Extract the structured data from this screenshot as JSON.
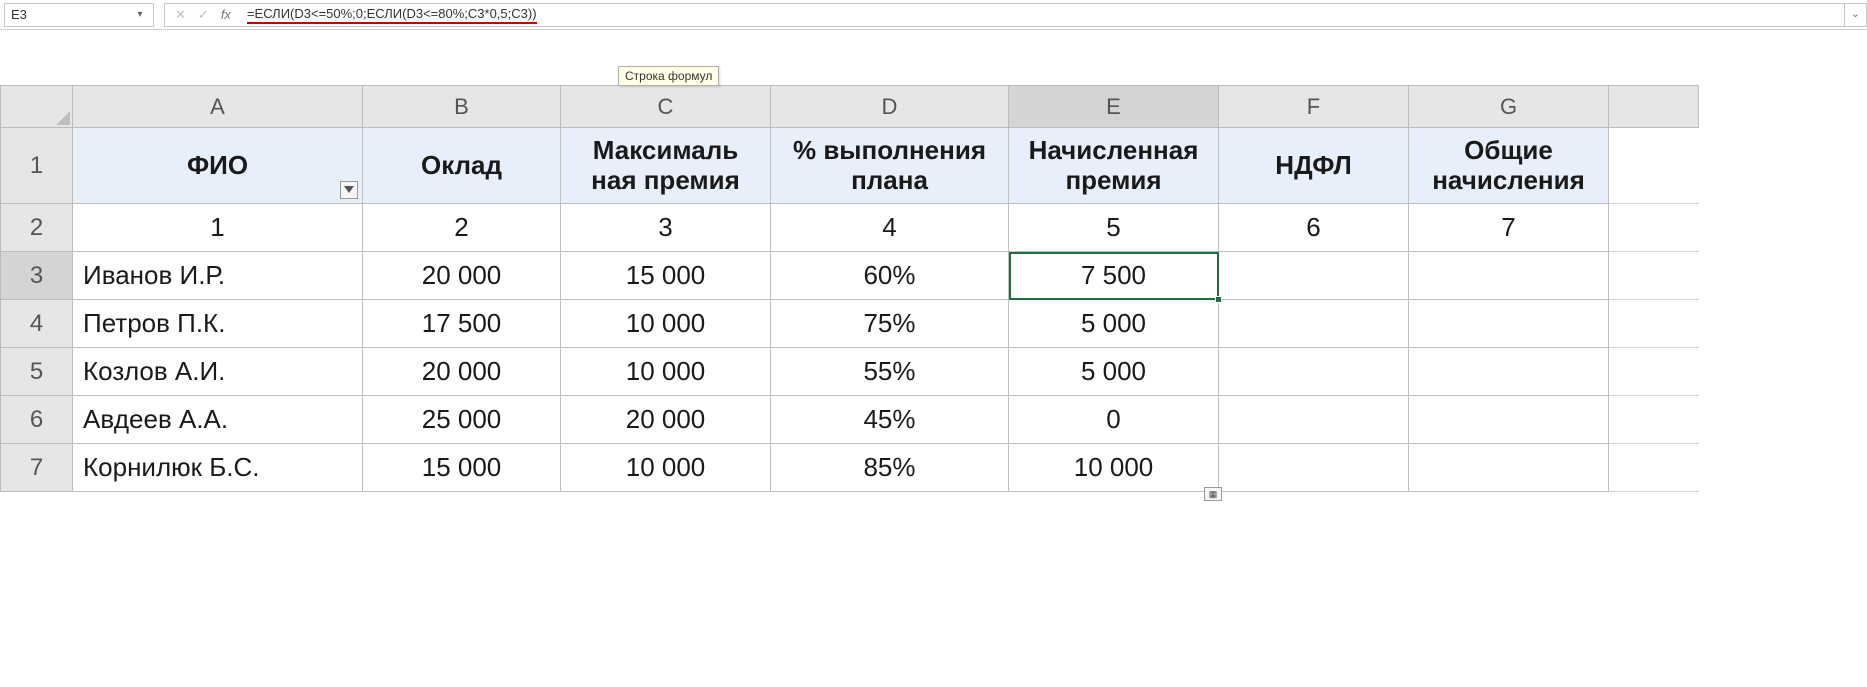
{
  "name_box": {
    "value": "E3"
  },
  "formula_bar": {
    "formula": "=ЕСЛИ(D3<=50%;0;ЕСЛИ(D3<=80%;C3*0,5;C3))",
    "tooltip": "Строка формул",
    "cancel_icon": "✕",
    "enter_icon": "✓",
    "fx_icon": "fx"
  },
  "columns": [
    "A",
    "B",
    "C",
    "D",
    "E",
    "F",
    "G"
  ],
  "selected_column": "E",
  "selected_row": "3",
  "active_cell": "E3",
  "headers": {
    "A": "ФИО",
    "B": "Оклад",
    "C": "Максималь\nная премия",
    "D": "% выполнения\nплана",
    "E": "Начисленная\nпремия",
    "F": "НДФЛ",
    "G": "Общие\nначисления"
  },
  "numrow": {
    "A": "1",
    "B": "2",
    "C": "3",
    "D": "4",
    "E": "5",
    "F": "6",
    "G": "7"
  },
  "rows": [
    {
      "n": "3",
      "A": "Иванов И.Р.",
      "B": "20 000",
      "C": "15 000",
      "D": "60%",
      "E": "7 500",
      "F": "",
      "G": ""
    },
    {
      "n": "4",
      "A": "Петров П.К.",
      "B": "17 500",
      "C": "10 000",
      "D": "75%",
      "E": "5 000",
      "F": "",
      "G": ""
    },
    {
      "n": "5",
      "A": "Козлов А.И.",
      "B": "20 000",
      "C": "10 000",
      "D": "55%",
      "E": "5 000",
      "F": "",
      "G": ""
    },
    {
      "n": "6",
      "A": "Авдеев А.А.",
      "B": "25 000",
      "C": "20 000",
      "D": "45%",
      "E": "0",
      "F": "",
      "G": ""
    },
    {
      "n": "7",
      "A": "Корнилюк Б.С.",
      "B": "15 000",
      "C": "10 000",
      "D": "85%",
      "E": "10 000",
      "F": "",
      "G": ""
    }
  ]
}
